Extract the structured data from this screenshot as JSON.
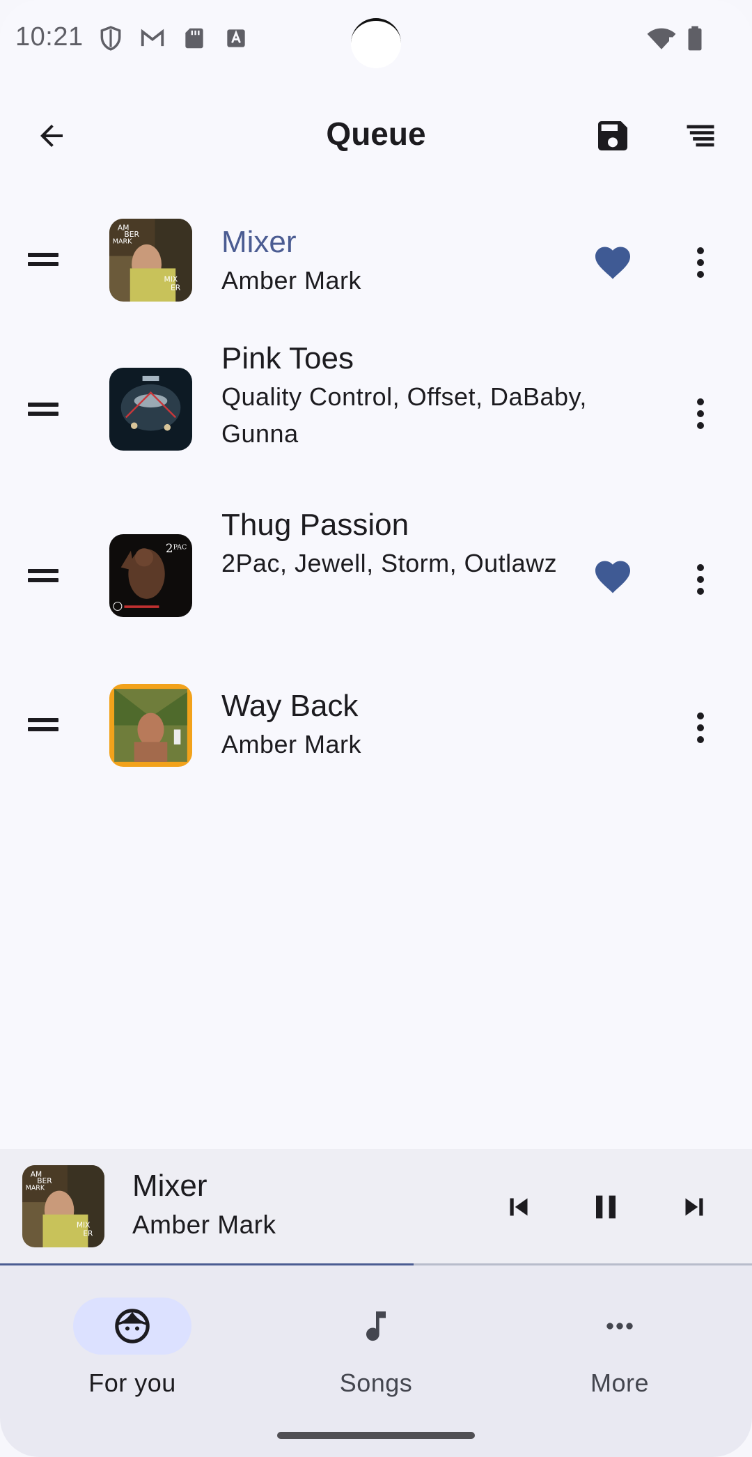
{
  "status_bar": {
    "time": "10:21"
  },
  "app_bar": {
    "title": "Queue"
  },
  "queue": [
    {
      "title": "Mixer",
      "artist": "Amber Mark",
      "playing": true,
      "favorite": true,
      "art": "amber-mark-mixer"
    },
    {
      "title": "Pink Toes",
      "artist": "Quality Control, Offset, DaBaby, Gunna",
      "playing": false,
      "favorite": false,
      "art": "control-the-streets"
    },
    {
      "title": "Thug Passion",
      "artist": "2Pac, Jewell, Storm, Outlawz",
      "playing": false,
      "favorite": true,
      "art": "2pac-all-eyez"
    },
    {
      "title": "Way Back",
      "artist": "Amber Mark",
      "playing": false,
      "favorite": false,
      "art": "amber-mark-way-back"
    }
  ],
  "mini_player": {
    "title": "Mixer",
    "artist": "Amber Mark",
    "progress": 0.55
  },
  "bottom_nav": [
    {
      "label": "For you",
      "icon": "face-icon",
      "active": true
    },
    {
      "label": "Songs",
      "icon": "music-note-icon",
      "active": false
    },
    {
      "label": "More",
      "icon": "more-horiz-icon",
      "active": false
    }
  ],
  "colors": {
    "accent": "#4b5c92",
    "background": "#f8f8fd",
    "nav_pill": "#dce1ff",
    "heart": "#3f5a94"
  }
}
